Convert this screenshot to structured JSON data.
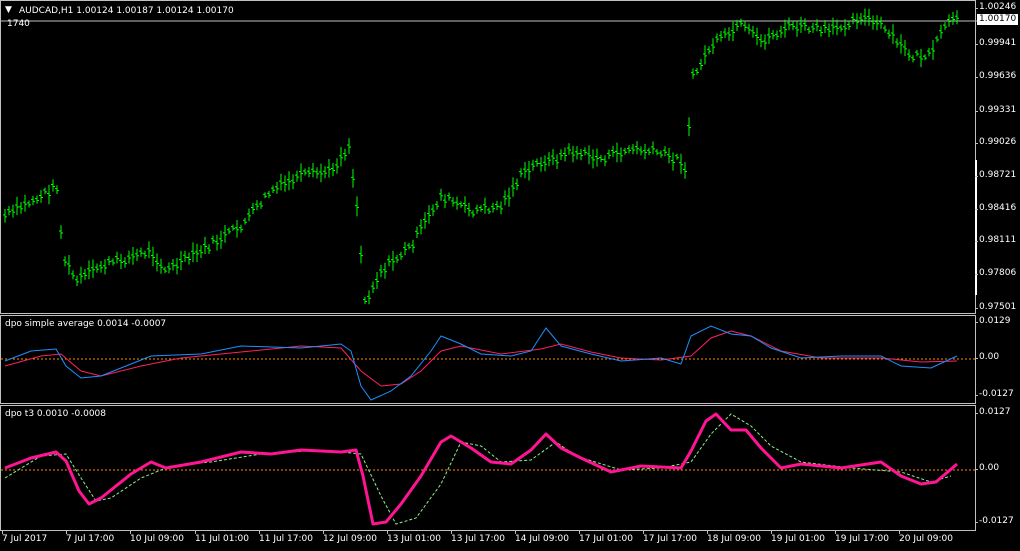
{
  "main": {
    "header": "AUDCAD,H1  1.00124 1.00187 1.00124 1.00170",
    "volume_label": "1740",
    "current_price": "1.00170",
    "price_ticks": [
      "1.00246",
      "0.99941",
      "0.99636",
      "0.99331",
      "0.99026",
      "0.98721",
      "0.98416",
      "0.98111",
      "0.97806",
      "0.97501"
    ],
    "colors": {
      "bars": "#00ff00",
      "price_line": "#c0c0c0",
      "grid": "#c0c0c0",
      "background": "#000000"
    }
  },
  "dpo1": {
    "title": "dpo simple average 0.0014 -0.0007",
    "ticks": [
      "0.0129",
      "0.00",
      "-0.0127"
    ],
    "colors": {
      "fast": "#1e90ff",
      "slow": "#ff2060",
      "zero": "#ff8c00"
    }
  },
  "dpo2": {
    "title": "dpo t3 0.0010 -0.0008",
    "ticks": [
      "0.0127",
      "0.00",
      "-0.0127"
    ],
    "colors": {
      "main": "#ff1493",
      "signal": "#90ee90",
      "zero": "#ff8c00"
    }
  },
  "time_axis": [
    "7 Jul 2017",
    "7 Jul 17:00",
    "10 Jul 09:00",
    "11 Jul 01:00",
    "11 Jul 17:00",
    "12 Jul 09:00",
    "13 Jul 01:00",
    "13 Jul 17:00",
    "14 Jul 09:00",
    "17 Jul 01:00",
    "17 Jul 17:00",
    "18 Jul 09:00",
    "19 Jul 01:00",
    "19 Jul 17:00",
    "20 Jul 09:00"
  ]
}
